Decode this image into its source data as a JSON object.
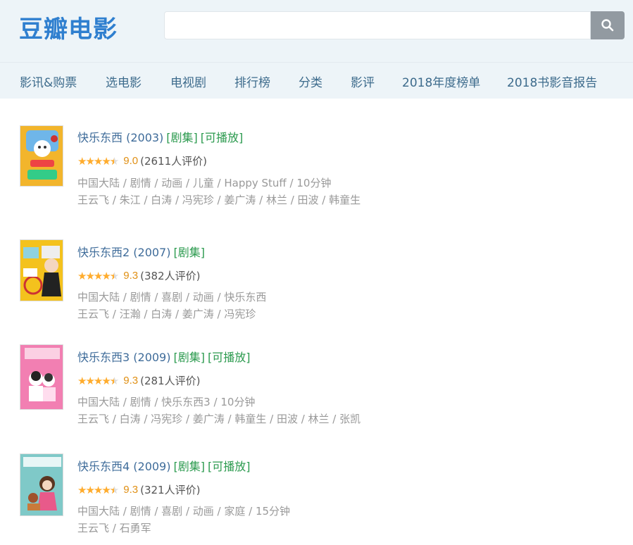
{
  "header": {
    "logo_text": "豆瓣电影",
    "search": {
      "value": "",
      "placeholder": ""
    },
    "search_button_icon": "search-icon"
  },
  "nav": {
    "items": [
      {
        "label": "影讯&购票"
      },
      {
        "label": "选电影"
      },
      {
        "label": "电视剧"
      },
      {
        "label": "排行榜"
      },
      {
        "label": "分类"
      },
      {
        "label": "影评"
      },
      {
        "label": "2018年度榜单"
      },
      {
        "label": "2018书影音报告"
      }
    ]
  },
  "results": [
    {
      "title": "快乐东西 (2003)",
      "tags": [
        "[剧集]",
        "[可播放]"
      ],
      "rating": 9.0,
      "score": "9.0",
      "count": "(2611人评价)",
      "meta": "中国大陆 / 剧情 / 动画 / 儿童 / Happy Stuff / 10分钟",
      "cast": "王云飞 / 朱江 / 白涛 / 冯宪珍 / 姜广涛 / 林兰 / 田波 / 韩童生",
      "poster_color": "#f2b52c"
    },
    {
      "title": "快乐东西2 (2007)",
      "tags": [
        "[剧集]"
      ],
      "rating": 9.3,
      "score": "9.3",
      "count": "(382人评价)",
      "meta": "中国大陆 / 剧情 / 喜剧 / 动画 / 快乐东西",
      "cast": "王云飞 / 汪瀚 / 白涛 / 姜广涛 / 冯宪珍",
      "poster_color": "#f4c21d"
    },
    {
      "title": "快乐东西3 (2009)",
      "tags": [
        "[剧集]",
        "[可播放]"
      ],
      "rating": 9.3,
      "score": "9.3",
      "count": "(281人评价)",
      "meta": "中国大陆 / 剧情 / 快乐东西3 / 10分钟",
      "cast": "王云飞 / 白涛 / 冯宪珍 / 姜广涛 / 韩童生 / 田波 / 林兰 / 张凯",
      "poster_color": "#f27fb2"
    },
    {
      "title": "快乐东西4 (2009)",
      "tags": [
        "[剧集]",
        "[可播放]"
      ],
      "rating": 9.3,
      "score": "9.3",
      "count": "(321人评价)",
      "meta": "中国大陆 / 剧情 / 喜剧 / 动画 / 家庭 / 15分钟",
      "cast": "王云飞 / 石勇军",
      "poster_color": "#7fc9c8"
    }
  ]
}
